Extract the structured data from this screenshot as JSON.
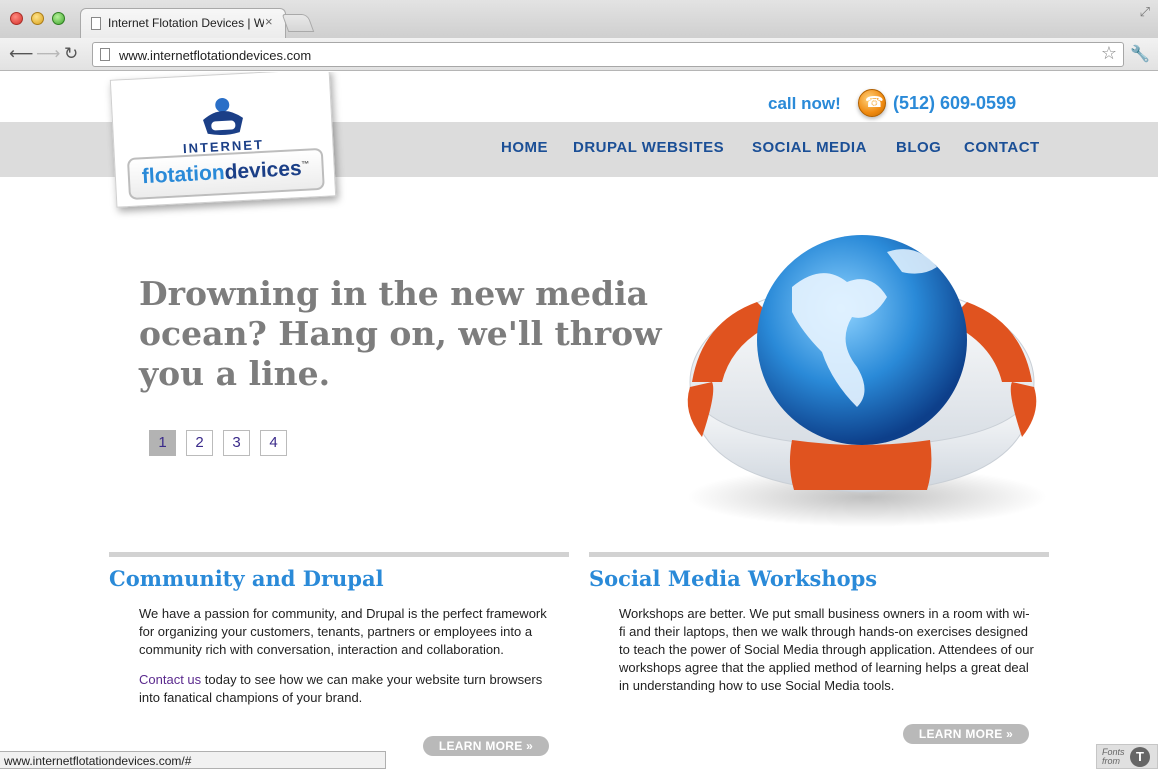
{
  "browser": {
    "tab_title": "Internet Flotation Devices | W",
    "tab_close": "×",
    "url": "www.internetflotationdevices.com",
    "status_url": "www.internetflotationdevices.com/#",
    "icons": [
      "page-icon",
      "close-icon",
      "back-arrow-icon",
      "forward-arrow-icon",
      "reload-icon",
      "star-icon",
      "wrench-icon",
      "resize-icon"
    ]
  },
  "logo": {
    "top": "INTERNET",
    "word_a": "flotation",
    "word_b": "devices",
    "tm": "™"
  },
  "header": {
    "call_now": "call now!",
    "phone": "(512) 609-0599"
  },
  "nav": [
    "HOME",
    "DRUPAL WEBSITES",
    "SOCIAL MEDIA",
    "BLOG",
    "CONTACT"
  ],
  "hero": {
    "headline": "Drowning in the new media ocean? Hang on, we'll throw you a line.",
    "pages": [
      "1",
      "2",
      "3",
      "4"
    ],
    "active_page": "1"
  },
  "columns": {
    "left": {
      "title": "Community and Drupal",
      "para1": "We have a passion for community, and Drupal is the perfect framework for organizing your customers, tenants, partners or employees into a community rich with conversation, interaction and collaboration.",
      "link": "Contact us",
      "para2_rest": " today to see how we can make your website turn browsers into fanatical champions of your brand.",
      "button": "LEARN MORE »"
    },
    "right": {
      "title": "Social Media Workshops",
      "para1": "Workshops are better. We put small business owners in a room with wi-fi and their laptops, then we walk through hands-on exercises designed to teach the power of Social Media through application. Attendees of our workshops agree that the applied method of learning helps a great deal in understanding how to use Social Media tools.",
      "button": "LEARN MORE »"
    }
  },
  "fonts_badge": {
    "text": "Fonts from",
    "logo": "T"
  },
  "colors": {
    "accent_blue": "#2a8ad8",
    "nav_blue": "#1b4f96",
    "headline_gray": "#7d7d7d",
    "band_gray": "#dcdcdc",
    "ring_orange": "#e0531f"
  }
}
